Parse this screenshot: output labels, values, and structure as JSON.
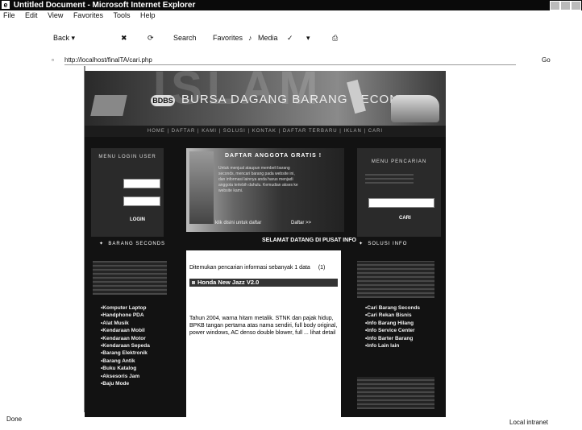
{
  "window": {
    "title": "Untitled Document - Microsoft Internet Explorer"
  },
  "menu": [
    "File",
    "Edit",
    "View",
    "Favorites",
    "Tools",
    "Help"
  ],
  "toolbar": {
    "back": "Back",
    "search": "Search",
    "favorites": "Favorites",
    "media": "Media"
  },
  "address": {
    "url": "http://localhost/finalTA/cari.php",
    "go": "Go"
  },
  "site": {
    "logo": "BDBS",
    "brand": "BURSA DAGANG BARANG SECONDS",
    "watermark": "ISLAM",
    "nav": "HOME | DAFTAR | KAMI | SOLUSI | KONTAK | DAFTAR TERBARU | IKLAN | CARI",
    "login": {
      "title": "MENU LOGIN USER",
      "button": "LOGIN"
    },
    "promo": {
      "title": "DAFTAR ANGGOTA GRATIS !",
      "text": "Untuk menjual ataupun membeli barang seconds, mencari barang pada website ini, dan informasi lainnya anda harus menjadi anggota terlebih dahulu. Kemudian akses ke website kami.",
      "link": "klik disini untuk daftar",
      "button": "Daftar >>"
    },
    "welcome": "SELAMAT DATANG DI PUSAT INFO",
    "search": {
      "title": "MENU PENCARIAN",
      "button": "CARI"
    },
    "left_section": "BARANG SECONDS",
    "categories": [
      "Komputer Laptop",
      "Handphone PDA",
      "Alat Musik",
      "Kendaraan Mobil",
      "Kendaraan Motor",
      "Kendaraan Sepeda",
      "Barang Elektronik",
      "Barang Antik",
      "Buku Katalog",
      "Aksesoris Jam",
      "Baju Mode"
    ],
    "right_section": "SOLUSI INFO",
    "info_links": [
      "Cari Barang Seconds",
      "Cari Rekan Bisnis",
      "Info Barang Hilang",
      "Info Service Center",
      "Info Barter Barang",
      "Info Lain lain"
    ],
    "results": {
      "found_text": "Ditemukan pencarian informasi sebanyak 1 data",
      "count": "(1)",
      "product_title": "Honda New Jazz V2.0",
      "description": "Tahun 2004, warna hitam metalik. STNK dan pajak hidup, BPKB tangan pertama atas nama sendiri, full body original, power windows, AC denso double blower, full ...",
      "more": "lihat detail"
    }
  },
  "status": {
    "left": "Done",
    "zone": "Local intranet"
  },
  "colors": {
    "page_bg": "#121212",
    "content_bg": "#ffffff",
    "title_bar": "#0a0a0a"
  }
}
